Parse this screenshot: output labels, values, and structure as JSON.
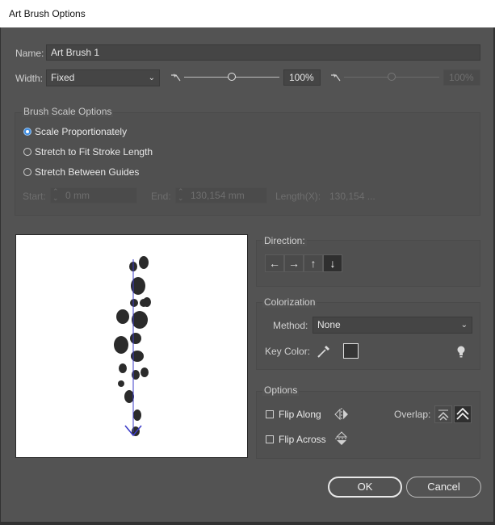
{
  "window": {
    "title": "Art Brush Options"
  },
  "name_row": {
    "label": "Name:",
    "value": "Art Brush 1"
  },
  "width_row": {
    "label": "Width:",
    "select_value": "Fixed",
    "slider1_value": 100,
    "field1_value": "100%",
    "slider2_value": 100,
    "field2_value": "100%"
  },
  "scale_options": {
    "title": "Brush Scale Options",
    "options": [
      "Scale Proportionately",
      "Stretch to Fit Stroke Length",
      "Stretch Between Guides"
    ],
    "selected": "Scale Proportionately",
    "start_label": "Start:",
    "start_value": "0 mm",
    "end_label": "End:",
    "end_value": "130,154 mm",
    "length_label": "Length(X):",
    "length_value": "130,154 ..."
  },
  "direction": {
    "title": "Direction:",
    "buttons": [
      {
        "icon": "arrow-left-icon",
        "glyph": "←"
      },
      {
        "icon": "arrow-right-icon",
        "glyph": "→"
      },
      {
        "icon": "arrow-up-icon",
        "glyph": "↑"
      },
      {
        "icon": "arrow-down-icon",
        "glyph": "↓"
      }
    ],
    "selected": "arrow-down-icon"
  },
  "colorization": {
    "title": "Colorization",
    "method_label": "Method:",
    "method_value": "None",
    "key_color_label": "Key Color:",
    "key_color": "#353535"
  },
  "options": {
    "title": "Options",
    "flip_along_label": "Flip Along",
    "flip_across_label": "Flip Across",
    "overlap_label": "Overlap:"
  },
  "buttons": {
    "ok_label": "OK",
    "cancel_label": "Cancel"
  },
  "colors": {
    "accent": "#3f8ce0",
    "dialog_bg": "#535353",
    "guide": "#3c3cc8"
  }
}
